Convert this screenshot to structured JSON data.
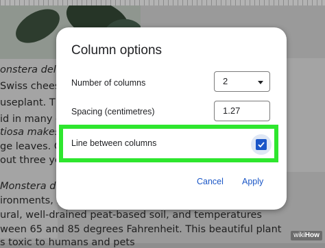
{
  "dialog": {
    "title": "Column options",
    "number_of_columns_label": "Number of columns",
    "number_of_columns_value": "2",
    "spacing_label": "Spacing (centimetres)",
    "spacing_value": "1.27",
    "line_between_label": "Line between columns",
    "line_between_checked": true,
    "cancel_label": "Cancel",
    "apply_label": "Apply",
    "colors": {
      "accent": "#1a56c6",
      "highlight": "#2ee62e"
    }
  },
  "document": {
    "lines": [
      "onstera delicio",
      "Swiss chees",
      "useplant. Thi",
      "id in many c",
      "tiosa makes",
      "ge leaves. Gro",
      "out three yea",
      "Monstera de",
      "ironments, re",
      "ural, well-drained peat-based soil, and temperatures",
      "ween 65 and 85 degrees Fahrenheit. This beautiful plant",
      "s toxic to humans and pets"
    ]
  },
  "watermark": {
    "prefix": "wiki",
    "suffix": "How"
  }
}
